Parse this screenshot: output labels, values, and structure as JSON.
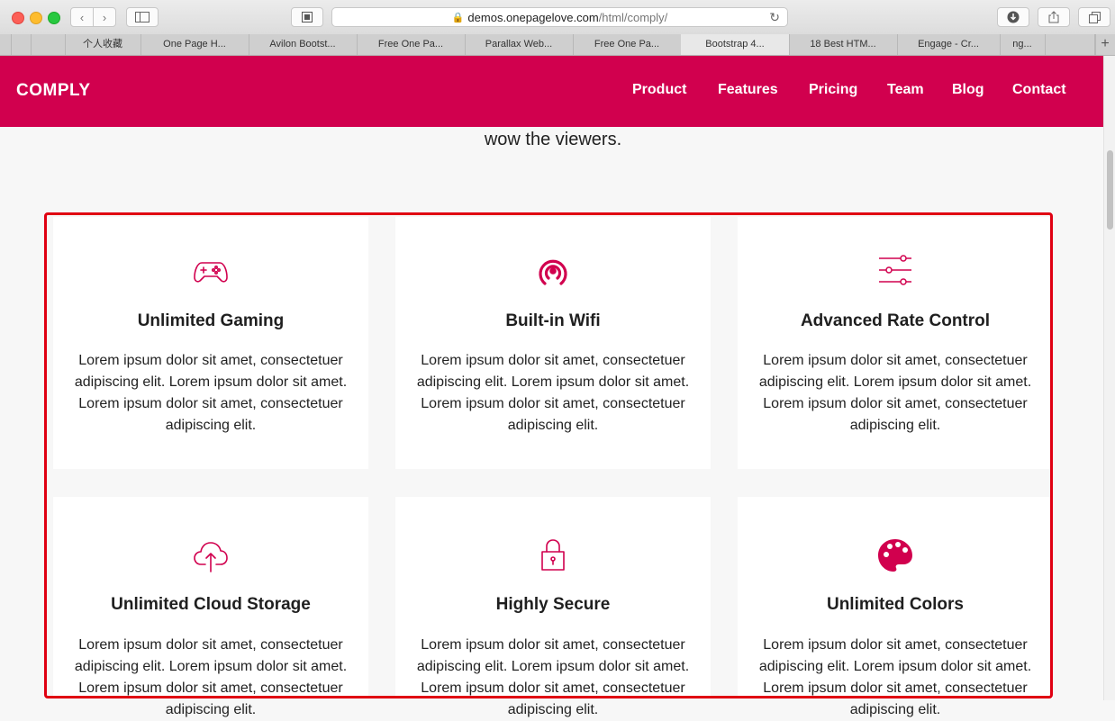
{
  "browser": {
    "url_host": "demos.onepagelove.com",
    "url_path": "/html/comply/",
    "tabs": [
      {
        "label": "个人收藏"
      },
      {
        "label": "One Page H..."
      },
      {
        "label": "Avilon Bootst..."
      },
      {
        "label": "Free One Pa..."
      },
      {
        "label": "Parallax Web..."
      },
      {
        "label": "Free One Pa..."
      },
      {
        "label": "Bootstrap 4...",
        "active": true
      },
      {
        "label": "18 Best HTM..."
      },
      {
        "label": "Engage - Cr..."
      },
      {
        "label": "ng..."
      }
    ]
  },
  "navbar": {
    "brand": "COMPLY",
    "links": [
      "Product",
      "Features",
      "Pricing",
      "Team",
      "Blog",
      "Contact"
    ]
  },
  "intro": {
    "text": "wow the viewers."
  },
  "features": [
    {
      "icon": "gamepad-icon",
      "title": "Unlimited Gaming",
      "text": "Lorem ipsum dolor sit amet, consectetuer adipiscing elit. Lorem ipsum dolor sit amet. Lorem ipsum dolor sit amet, consectetuer adipiscing elit."
    },
    {
      "icon": "wifi-icon",
      "title": "Built-in Wifi",
      "text": "Lorem ipsum dolor sit amet, consectetuer adipiscing elit. Lorem ipsum dolor sit amet. Lorem ipsum dolor sit amet, consectetuer adipiscing elit."
    },
    {
      "icon": "sliders-icon",
      "title": "Advanced Rate Control",
      "text": "Lorem ipsum dolor sit amet, consectetuer adipiscing elit. Lorem ipsum dolor sit amet. Lorem ipsum dolor sit amet, consectetuer adipiscing elit."
    },
    {
      "icon": "cloud-upload-icon",
      "title": "Unlimited Cloud Storage",
      "text": "Lorem ipsum dolor sit amet, consectetuer adipiscing elit. Lorem ipsum dolor sit amet. Lorem ipsum dolor sit amet, consectetuer adipiscing elit."
    },
    {
      "icon": "lock-icon",
      "title": "Highly Secure",
      "text": "Lorem ipsum dolor sit amet, consectetuer adipiscing elit. Lorem ipsum dolor sit amet. Lorem ipsum dolor sit amet, consectetuer adipiscing elit."
    },
    {
      "icon": "palette-icon",
      "title": "Unlimited Colors",
      "text": "Lorem ipsum dolor sit amet, consectetuer adipiscing elit. Lorem ipsum dolor sit amet. Lorem ipsum dolor sit amet, consectetuer adipiscing elit."
    }
  ],
  "colors": {
    "brand": "#d1004e",
    "highlight": "#e00012"
  }
}
